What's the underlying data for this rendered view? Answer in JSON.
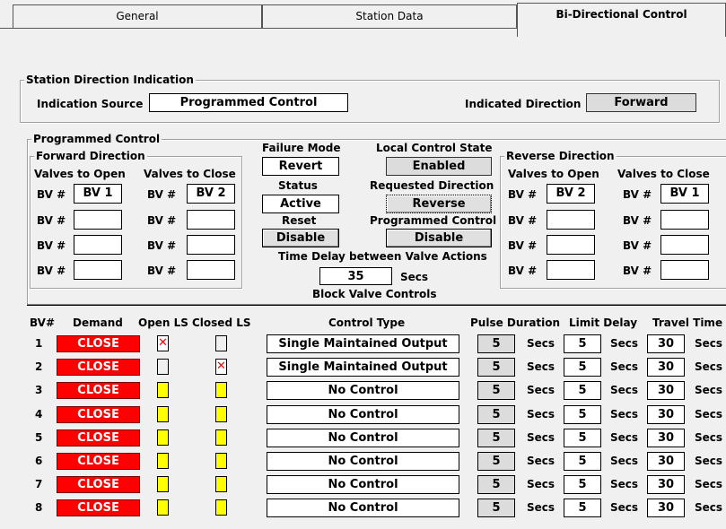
{
  "tabs": [
    {
      "label": "General",
      "active": false
    },
    {
      "label": "Station Data",
      "active": false
    },
    {
      "label": "Bi-Directional Control",
      "active": true
    }
  ],
  "station_direction": {
    "legend": "Station Direction Indication",
    "source_label": "Indication Source",
    "source_value": "Programmed Control",
    "direction_label": "Indicated Direction",
    "direction_value": "Forward"
  },
  "programmed_control": {
    "legend": "Programmed Control",
    "forward": {
      "legend": "Forward Direction",
      "open_header": "Valves to Open",
      "close_header": "Valves to Close",
      "bv_label": "BV #",
      "open": [
        "BV 1",
        "",
        "",
        ""
      ],
      "close": [
        "BV 2",
        "",
        "",
        ""
      ]
    },
    "reverse": {
      "legend": "Reverse Direction",
      "open_header": "Valves to Open",
      "close_header": "Valves to Close",
      "bv_label": "BV #",
      "open": [
        "BV 2",
        "",
        "",
        ""
      ],
      "close": [
        "BV 1",
        "",
        "",
        ""
      ]
    },
    "failure_mode_label": "Failure Mode",
    "failure_mode_value": "Revert",
    "status_label": "Status",
    "status_value": "Active",
    "reset_label": "Reset",
    "reset_button": "Disable",
    "local_control_label": "Local Control State",
    "local_control_value": "Enabled",
    "requested_direction_label": "Requested Direction",
    "requested_direction_button": "Reverse",
    "programmed_control_label": "Programmed Control",
    "programmed_control_button": "Disable",
    "time_delay_label": "Time Delay between Valve Actions",
    "time_delay_value": "35",
    "time_delay_unit": "Secs",
    "block_valve_label": "Block Valve Controls"
  },
  "block_valves": {
    "headers": {
      "bv": "BV#",
      "demand": "Demand",
      "open_ls": "Open LS",
      "closed_ls": "Closed LS",
      "control_type": "Control Type",
      "pulse_duration": "Pulse Duration",
      "limit_delay": "Limit Delay",
      "travel_time": "Travel Time"
    },
    "unit": "Secs",
    "rows": [
      {
        "bv": "1",
        "demand": "CLOSE",
        "open_ls": "x",
        "closed_ls": "w",
        "control_type": "Single Maintained Output",
        "pulse": "5",
        "limit": "5",
        "travel": "30"
      },
      {
        "bv": "2",
        "demand": "CLOSE",
        "open_ls": "w",
        "closed_ls": "x",
        "control_type": "Single Maintained Output",
        "pulse": "5",
        "limit": "5",
        "travel": "30"
      },
      {
        "bv": "3",
        "demand": "CLOSE",
        "open_ls": "y",
        "closed_ls": "y",
        "control_type": "No Control",
        "pulse": "5",
        "limit": "5",
        "travel": "30"
      },
      {
        "bv": "4",
        "demand": "CLOSE",
        "open_ls": "y",
        "closed_ls": "y",
        "control_type": "No Control",
        "pulse": "5",
        "limit": "5",
        "travel": "30"
      },
      {
        "bv": "5",
        "demand": "CLOSE",
        "open_ls": "y",
        "closed_ls": "y",
        "control_type": "No Control",
        "pulse": "5",
        "limit": "5",
        "travel": "30"
      },
      {
        "bv": "6",
        "demand": "CLOSE",
        "open_ls": "y",
        "closed_ls": "y",
        "control_type": "No Control",
        "pulse": "5",
        "limit": "5",
        "travel": "30"
      },
      {
        "bv": "7",
        "demand": "CLOSE",
        "open_ls": "y",
        "closed_ls": "y",
        "control_type": "No Control",
        "pulse": "5",
        "limit": "5",
        "travel": "30"
      },
      {
        "bv": "8",
        "demand": "CLOSE",
        "open_ls": "y",
        "closed_ls": "y",
        "control_type": "No Control",
        "pulse": "5",
        "limit": "5",
        "travel": "30"
      }
    ]
  },
  "colors": {
    "demand_bg": "#ff0000",
    "limit_switch_active": "#ffff00",
    "fault_x": "#ff0000"
  }
}
